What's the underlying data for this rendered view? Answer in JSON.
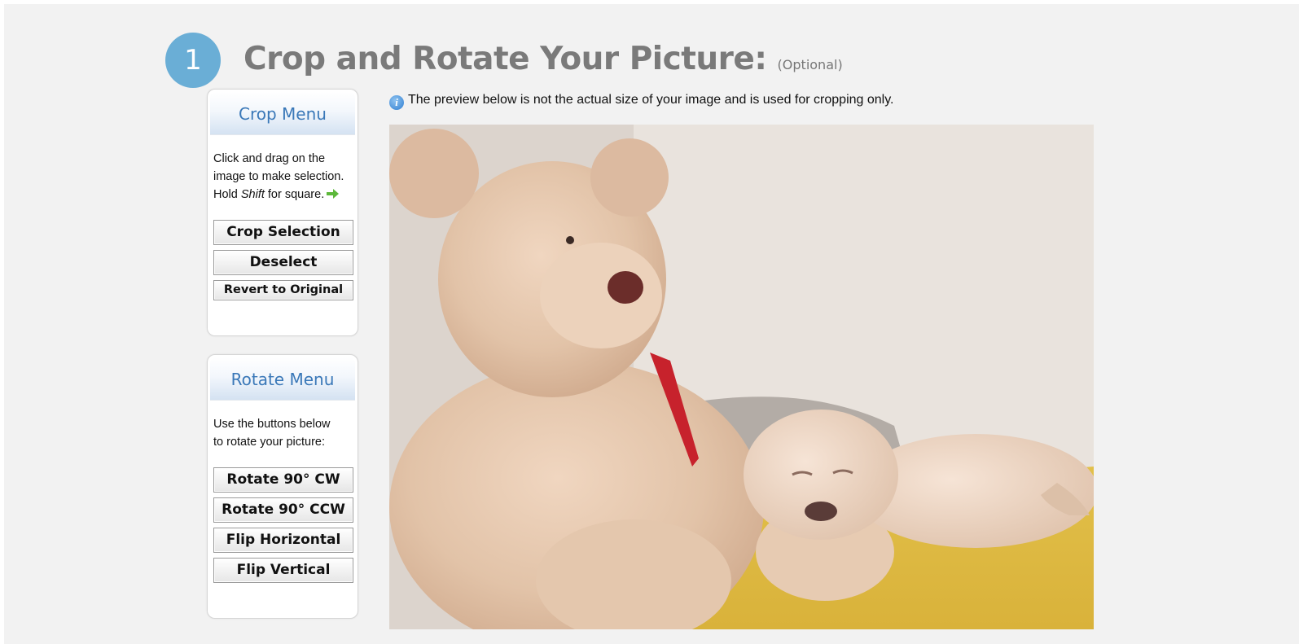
{
  "step": {
    "number": "1"
  },
  "header": {
    "title": "Crop and Rotate Your Picture:",
    "optional": "(Optional)"
  },
  "info": {
    "text": "The preview below is not the actual size of your image and is used for cropping only.",
    "icon": "info-icon"
  },
  "crop_menu": {
    "title": "Crop Menu",
    "instructions_line1": "Click and drag on the",
    "instructions_line2": "image to make selection.",
    "instructions_hold": "Hold ",
    "instructions_shift": "Shift",
    "instructions_end": " for square.",
    "arrow_icon": "arrow-right-icon",
    "buttons": {
      "crop_selection": "Crop Selection",
      "deselect": "Deselect",
      "revert": "Revert to Original"
    }
  },
  "rotate_menu": {
    "title": "Rotate Menu",
    "instructions_line1": "Use the buttons below",
    "instructions_line2": "to rotate your picture:",
    "buttons": {
      "rotate_cw": "Rotate 90° CW",
      "rotate_ccw": "Rotate 90° CCW",
      "flip_horizontal": "Flip Horizontal",
      "flip_vertical": "Flip Vertical"
    }
  },
  "colors": {
    "accent": "#6aaed6",
    "menu_title": "#3a78b8",
    "title_gray": "#7a7a7a",
    "bedspread_yellow": "#e8c94a",
    "plush_beige": "#e6c9b0"
  }
}
